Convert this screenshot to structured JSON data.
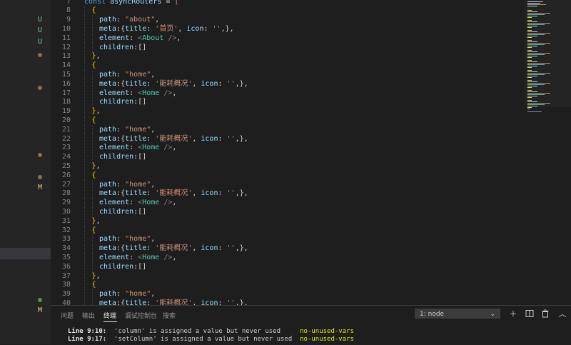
{
  "colors": {
    "default": "#d4d4d4",
    "key": "#9cdcfe",
    "string": "#ce9178",
    "tag": "#4ec9b0",
    "punct": "#808080",
    "bracket1": "#da70d6",
    "bracket2": "#ffd700",
    "keyword": "#569cd6",
    "scm_untracked": "#73c991",
    "scm_modified": "#e2c08d",
    "scm_dot": "#8c6f4e",
    "scm_dot_green": "#4a9a4a"
  },
  "sidebar": {
    "decorations": [
      {
        "kind": "text",
        "text": "U",
        "color": "#73c991"
      },
      {
        "kind": "text",
        "text": "U",
        "color": "#73c991"
      },
      {
        "kind": "text",
        "text": "U",
        "color": "#73c991"
      },
      {
        "kind": "dot",
        "color": "#8c6f4e"
      },
      {
        "kind": "dot",
        "color": "#8c6f4e"
      },
      {
        "kind": "dot",
        "color": "#8c6f4e"
      },
      {
        "kind": "dot",
        "color": "#8c6f4e"
      },
      {
        "kind": "text",
        "text": "M",
        "color": "#e2c08d"
      },
      {
        "kind": "dot",
        "color": "#4a9a4a"
      },
      {
        "kind": "text",
        "text": "M",
        "color": "#e2c08d"
      }
    ]
  },
  "editor": {
    "lines": [
      {
        "n": "7",
        "indent": 0,
        "tokens": [
          [
            "keyword",
            "const "
          ],
          [
            "key",
            "asyncRouters"
          ],
          [
            "default",
            " = "
          ],
          [
            "bracket1",
            "["
          ]
        ]
      },
      {
        "n": "8",
        "indent": 1,
        "tokens": [
          [
            "bracket2",
            "{"
          ]
        ]
      },
      {
        "n": "9",
        "indent": 2,
        "tokens": [
          [
            "key",
            "path"
          ],
          [
            "default",
            ": "
          ],
          [
            "string",
            "\"about\""
          ],
          [
            "default",
            ","
          ]
        ]
      },
      {
        "n": "10",
        "indent": 2,
        "tokens": [
          [
            "key",
            "meta"
          ],
          [
            "default",
            ":{"
          ],
          [
            "key",
            "title"
          ],
          [
            "default",
            ": "
          ],
          [
            "string",
            "'首页'"
          ],
          [
            "default",
            ", "
          ],
          [
            "key",
            "icon"
          ],
          [
            "default",
            ": "
          ],
          [
            "string",
            "''"
          ],
          [
            "default",
            ",},"
          ]
        ]
      },
      {
        "n": "11",
        "indent": 2,
        "tokens": [
          [
            "key",
            "element"
          ],
          [
            "default",
            ": "
          ],
          [
            "punct",
            "<"
          ],
          [
            "tag",
            "About"
          ],
          [
            "punct",
            " />"
          ],
          [
            "default",
            ","
          ]
        ]
      },
      {
        "n": "12",
        "indent": 2,
        "tokens": [
          [
            "key",
            "children"
          ],
          [
            "default",
            ":[]"
          ]
        ]
      },
      {
        "n": "13",
        "indent": 1,
        "tokens": [
          [
            "bracket2",
            "}"
          ],
          [
            "default",
            ","
          ]
        ]
      },
      {
        "n": "14",
        "indent": 1,
        "tokens": [
          [
            "bracket2",
            "{"
          ]
        ]
      },
      {
        "n": "15",
        "indent": 2,
        "tokens": [
          [
            "key",
            "path"
          ],
          [
            "default",
            ": "
          ],
          [
            "string",
            "\"home\""
          ],
          [
            "default",
            ","
          ]
        ]
      },
      {
        "n": "16",
        "indent": 2,
        "tokens": [
          [
            "key",
            "meta"
          ],
          [
            "default",
            ":{"
          ],
          [
            "key",
            "title"
          ],
          [
            "default",
            ": "
          ],
          [
            "string",
            "'能耗概况'"
          ],
          [
            "default",
            ", "
          ],
          [
            "key",
            "icon"
          ],
          [
            "default",
            ": "
          ],
          [
            "string",
            "''"
          ],
          [
            "default",
            ",},"
          ]
        ]
      },
      {
        "n": "17",
        "indent": 2,
        "tokens": [
          [
            "key",
            "element"
          ],
          [
            "default",
            ": "
          ],
          [
            "punct",
            "<"
          ],
          [
            "tag",
            "Home"
          ],
          [
            "punct",
            " />"
          ],
          [
            "default",
            ","
          ]
        ]
      },
      {
        "n": "18",
        "indent": 2,
        "tokens": [
          [
            "key",
            "children"
          ],
          [
            "default",
            ":[]"
          ]
        ]
      },
      {
        "n": "19",
        "indent": 1,
        "tokens": [
          [
            "bracket2",
            "}"
          ],
          [
            "default",
            ","
          ]
        ]
      },
      {
        "n": "20",
        "indent": 1,
        "tokens": [
          [
            "bracket2",
            "{"
          ]
        ]
      },
      {
        "n": "21",
        "indent": 2,
        "tokens": [
          [
            "key",
            "path"
          ],
          [
            "default",
            ": "
          ],
          [
            "string",
            "\"home\""
          ],
          [
            "default",
            ","
          ]
        ]
      },
      {
        "n": "22",
        "indent": 2,
        "tokens": [
          [
            "key",
            "meta"
          ],
          [
            "default",
            ":{"
          ],
          [
            "key",
            "title"
          ],
          [
            "default",
            ": "
          ],
          [
            "string",
            "'能耗概况'"
          ],
          [
            "default",
            ", "
          ],
          [
            "key",
            "icon"
          ],
          [
            "default",
            ": "
          ],
          [
            "string",
            "''"
          ],
          [
            "default",
            ",},"
          ]
        ]
      },
      {
        "n": "23",
        "indent": 2,
        "tokens": [
          [
            "key",
            "element"
          ],
          [
            "default",
            ": "
          ],
          [
            "punct",
            "<"
          ],
          [
            "tag",
            "Home"
          ],
          [
            "punct",
            " />"
          ],
          [
            "default",
            ","
          ]
        ]
      },
      {
        "n": "24",
        "indent": 2,
        "tokens": [
          [
            "key",
            "children"
          ],
          [
            "default",
            ":[]"
          ]
        ]
      },
      {
        "n": "25",
        "indent": 1,
        "tokens": [
          [
            "bracket2",
            "}"
          ],
          [
            "default",
            ","
          ]
        ]
      },
      {
        "n": "26",
        "indent": 1,
        "tokens": [
          [
            "bracket2",
            "{"
          ]
        ]
      },
      {
        "n": "27",
        "indent": 2,
        "tokens": [
          [
            "key",
            "path"
          ],
          [
            "default",
            ": "
          ],
          [
            "string",
            "\"home\""
          ],
          [
            "default",
            ","
          ]
        ]
      },
      {
        "n": "28",
        "indent": 2,
        "tokens": [
          [
            "key",
            "meta"
          ],
          [
            "default",
            ":{"
          ],
          [
            "key",
            "title"
          ],
          [
            "default",
            ": "
          ],
          [
            "string",
            "'能耗概况'"
          ],
          [
            "default",
            ", "
          ],
          [
            "key",
            "icon"
          ],
          [
            "default",
            ": "
          ],
          [
            "string",
            "''"
          ],
          [
            "default",
            ",},"
          ]
        ]
      },
      {
        "n": "29",
        "indent": 2,
        "tokens": [
          [
            "key",
            "element"
          ],
          [
            "default",
            ": "
          ],
          [
            "punct",
            "<"
          ],
          [
            "tag",
            "Home"
          ],
          [
            "punct",
            " />"
          ],
          [
            "default",
            ","
          ]
        ]
      },
      {
        "n": "30",
        "indent": 2,
        "tokens": [
          [
            "key",
            "children"
          ],
          [
            "default",
            ":[]"
          ]
        ]
      },
      {
        "n": "31",
        "indent": 1,
        "tokens": [
          [
            "bracket2",
            "}"
          ],
          [
            "default",
            ","
          ]
        ]
      },
      {
        "n": "32",
        "indent": 1,
        "tokens": [
          [
            "bracket2",
            "{"
          ]
        ]
      },
      {
        "n": "33",
        "indent": 2,
        "tokens": [
          [
            "key",
            "path"
          ],
          [
            "default",
            ": "
          ],
          [
            "string",
            "\"home\""
          ],
          [
            "default",
            ","
          ]
        ]
      },
      {
        "n": "34",
        "indent": 2,
        "tokens": [
          [
            "key",
            "meta"
          ],
          [
            "default",
            ":{"
          ],
          [
            "key",
            "title"
          ],
          [
            "default",
            ": "
          ],
          [
            "string",
            "'能耗概况'"
          ],
          [
            "default",
            ", "
          ],
          [
            "key",
            "icon"
          ],
          [
            "default",
            ": "
          ],
          [
            "string",
            "''"
          ],
          [
            "default",
            ",},"
          ]
        ]
      },
      {
        "n": "35",
        "indent": 2,
        "tokens": [
          [
            "key",
            "element"
          ],
          [
            "default",
            ": "
          ],
          [
            "punct",
            "<"
          ],
          [
            "tag",
            "Home"
          ],
          [
            "punct",
            " />"
          ],
          [
            "default",
            ","
          ]
        ]
      },
      {
        "n": "36",
        "indent": 2,
        "tokens": [
          [
            "key",
            "children"
          ],
          [
            "default",
            ":[]"
          ]
        ]
      },
      {
        "n": "37",
        "indent": 1,
        "tokens": [
          [
            "bracket2",
            "}"
          ],
          [
            "default",
            ","
          ]
        ]
      },
      {
        "n": "38",
        "indent": 1,
        "tokens": [
          [
            "bracket2",
            "{"
          ]
        ]
      },
      {
        "n": "39",
        "indent": 2,
        "tokens": [
          [
            "key",
            "path"
          ],
          [
            "default",
            ": "
          ],
          [
            "string",
            "\"home\""
          ],
          [
            "default",
            ","
          ]
        ]
      },
      {
        "n": "40",
        "indent": 2,
        "tokens": [
          [
            "key",
            "meta"
          ],
          [
            "default",
            ":{"
          ],
          [
            "key",
            "title"
          ],
          [
            "default",
            ": "
          ],
          [
            "string",
            "'能耗概况'"
          ],
          [
            "default",
            ", "
          ],
          [
            "key",
            "icon"
          ],
          [
            "default",
            ": "
          ],
          [
            "string",
            "''"
          ],
          [
            "default",
            ",},"
          ]
        ]
      }
    ]
  },
  "panel": {
    "tabs": [
      {
        "label": "问题",
        "active": false
      },
      {
        "label": "输出",
        "active": false
      },
      {
        "label": "终端",
        "active": true
      },
      {
        "label": "调试控制台",
        "active": false
      },
      {
        "label": "搜索",
        "active": false
      }
    ],
    "terminal_select": "1: node",
    "terminal_lines": [
      {
        "loc": "Line 9:10:",
        "msg": "  'column' is assigned a value but never used     ",
        "rule": "no-unused-vars"
      },
      {
        "loc": "Line 9:17:",
        "msg": "  'setColumn' is assigned a value but never used  ",
        "rule": "no-unused-vars"
      }
    ]
  }
}
